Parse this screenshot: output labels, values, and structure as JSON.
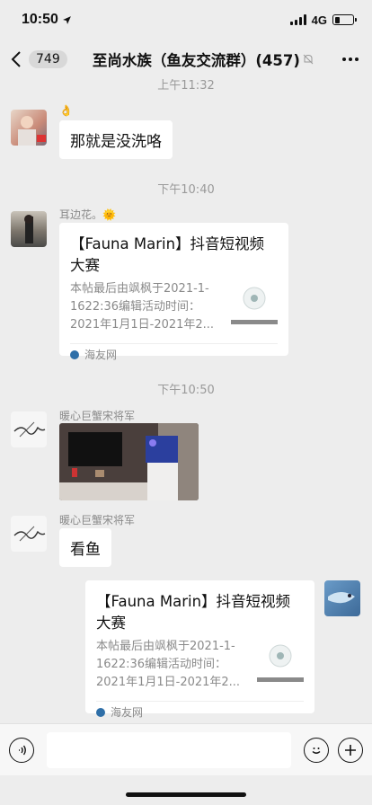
{
  "status": {
    "time": "10:50",
    "network": "4G",
    "battery_level": 0.3
  },
  "nav": {
    "unread_count": "749",
    "title": "至尚水族（鱼友交流群）(457)",
    "icons": [
      "back-chevron-icon",
      "mute-bell-icon",
      "more-dots-icon"
    ]
  },
  "timestamps": [
    "上午11:32",
    "下午10:40",
    "下午10:50"
  ],
  "messages": [
    {
      "sender": "👌",
      "text": "那就是没洗咯"
    },
    {
      "sender": "耳边花。🌞",
      "card": {
        "title": "【Fauna Marin】抖音短视频大赛",
        "desc": "本帖最后由飒枫于2021-1-1622:36编辑活动时间：2021年1月1日-2021年2...",
        "source": "海友网"
      }
    },
    {
      "sender": "暖心巨蟹宋将军",
      "type": "image"
    },
    {
      "sender": "暖心巨蟹宋将军",
      "text": "看鱼"
    },
    {
      "self": true,
      "card": {
        "title": "【Fauna Marin】抖音短视频大赛",
        "desc": "本帖最后由飒枫于2021-1-1622:36编辑活动时间：2021年1月1日-2021年2...",
        "source": "海友网"
      }
    }
  ],
  "input_bar": {
    "icons": [
      "voice-icon",
      "emoji-icon",
      "plus-icon"
    ]
  },
  "colors": {
    "background": "#ededed",
    "bubble": "#ffffff",
    "timestamp": "#9a9a9a"
  }
}
